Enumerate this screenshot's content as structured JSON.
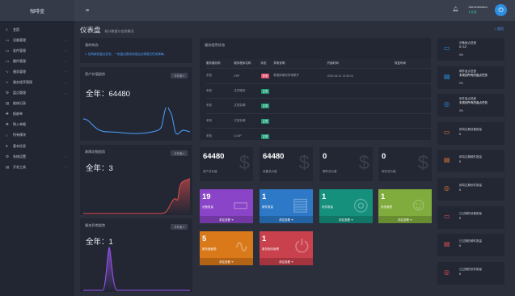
{
  "brand": "咖啡壶",
  "menu": [
    {
      "icon": "≡",
      "label": "主页",
      "arrow": ""
    },
    {
      "icon": "▭",
      "label": "设备管理",
      "arrow": "‹"
    },
    {
      "icon": "▭",
      "label": "软件管理",
      "arrow": "‹"
    },
    {
      "icon": "▭",
      "label": "硬件管理",
      "arrow": "‹"
    },
    {
      "icon": "∿",
      "label": "服务管理",
      "arrow": "‹"
    },
    {
      "icon": "∿",
      "label": "服务程序管理",
      "arrow": "‹"
    },
    {
      "icon": "⚙",
      "label": "盘点管理",
      "arrow": "‹"
    },
    {
      "icon": "▤",
      "label": "维修记录",
      "arrow": ""
    },
    {
      "icon": "✚",
      "label": "报废单",
      "arrow": ""
    },
    {
      "icon": "✚",
      "label": "购入单据",
      "arrow": ""
    },
    {
      "icon": "○",
      "label": "所有模块",
      "arrow": ""
    },
    {
      "icon": "●",
      "label": "基本信息",
      "arrow": ""
    },
    {
      "icon": "⚙",
      "label": "系统设置",
      "arrow": "‹"
    },
    {
      "icon": "▤",
      "label": "开发工具",
      "arrow": "‹"
    }
  ],
  "topbar": {
    "user": "Administrator",
    "status": "● 在线"
  },
  "page": {
    "title": "仪表盘",
    "subtitle": "统计数据与信息概况",
    "crumb": "⌂ 首页"
  },
  "todo": {
    "title": "我的待办",
    "text": "1. 您有新的盘点任务，一份盘点表待完成后记得提交任务清单。"
  },
  "trend1": {
    "title": "资产价值趋势",
    "tag": "今年度 ▾",
    "year": "全年：64480"
  },
  "trend2": {
    "title": "故障次数趋势",
    "tag": "今年度 ▾",
    "year": "全年：3"
  },
  "trend3": {
    "title": "服务异常趋势",
    "tag": "今年度 ▾",
    "year": "全年：1"
  },
  "service": {
    "title": "服务程序状态",
    "headers": [
      "服务器名称",
      "服务程序名称",
      "状态",
      "异常说明",
      "开始时间",
      "恢复时间"
    ],
    "rows": [
      [
        "未知",
        "ERP",
        "异常",
        "数据库服务异常断开",
        "2020-06-11 13:36:14",
        ""
      ],
      [
        "未知",
        "文件服务",
        "正常",
        "",
        "",
        ""
      ],
      [
        "未知",
        "文档协调",
        "正常",
        "",
        "",
        ""
      ],
      [
        "未知",
        "文档协调",
        "正常",
        "",
        "",
        ""
      ],
      [
        "未知",
        "LDAP",
        "正常",
        "",
        "",
        ""
      ]
    ]
  },
  "stats": [
    {
      "num": "64480",
      "label": "资产总价值",
      "icon": "$"
    },
    {
      "num": "64480",
      "label": "设备总价值",
      "icon": "$"
    },
    {
      "num": "0",
      "label": "硬件总价值",
      "icon": "$"
    },
    {
      "num": "0",
      "label": "软件总价值",
      "icon": "$"
    }
  ],
  "colorboxes": [
    {
      "num": "19",
      "label": "设备数量",
      "foot": "前往查看 ➜",
      "color": "#8a44c7",
      "icon": "▭"
    },
    {
      "num": "1",
      "label": "硬件数量",
      "foot": "前往查看 ➜",
      "color": "#2d79c7",
      "icon": "▤"
    },
    {
      "num": "1",
      "label": "软件数量",
      "foot": "前往查看 ➜",
      "color": "#15907c",
      "icon": "◎"
    },
    {
      "num": "1",
      "label": "系统管理",
      "foot": "前往查看 ➜",
      "color": "#7fac3c",
      "icon": "☺"
    },
    {
      "num": "5",
      "label": "服务器管理",
      "foot": "前往查看 ➜",
      "color": "#d97919",
      "icon": "∿"
    },
    {
      "num": "1",
      "label": "服务程序管理",
      "foot": "前往查看 ➜",
      "color": "#c9414d",
      "icon": "⏻"
    }
  ],
  "rcards": [
    {
      "icon": "▭",
      "color": "#2e8ee0",
      "t1": "设备盘点进度",
      "t2": "0 / 12",
      "t3": "",
      "pct": "0%"
    },
    {
      "icon": "▤",
      "color": "#2e8ee0",
      "t1": "硬件盘点进度",
      "t2": "未规划所有的盘点任务",
      "t3": "",
      "pct": "0%"
    },
    {
      "icon": "◎",
      "color": "#2e8ee0",
      "t1": "软件盘点进度",
      "t2": "未规划所有的盘点任务",
      "t3": "",
      "pct": "0%"
    },
    {
      "icon": "▭",
      "color": "#e0762e",
      "t1": "即将过期设备数量",
      "t2": "0"
    },
    {
      "icon": "▤",
      "color": "#e0762e",
      "t1": "即将过期硬件数量",
      "t2": "0"
    },
    {
      "icon": "◎",
      "color": "#e0762e",
      "t1": "即将过期软件数量",
      "t2": "0"
    },
    {
      "icon": "▭",
      "color": "#e04e4e",
      "t1": "已过期的设备数量",
      "t2": "0"
    },
    {
      "icon": "▤",
      "color": "#e04e4e",
      "t1": "已过期的硬件数量",
      "t2": "0"
    },
    {
      "icon": "◎",
      "color": "#e04e4e",
      "t1": "已过期的软件数量",
      "t2": "0"
    }
  ]
}
